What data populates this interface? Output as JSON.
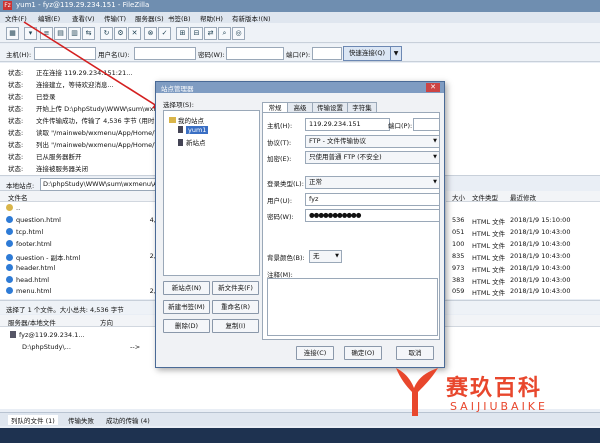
{
  "window": {
    "title": "yum1 - fyz@119.29.234.151 - FileZilla",
    "app_icon": "filezilla-icon"
  },
  "menu": [
    "文件(F)",
    "编辑(E)",
    "查看(V)",
    "传输(T)",
    "服务器(S)",
    "书签(B)",
    "帮助(H)",
    "有新版本!(N)"
  ],
  "quickconnect": {
    "host_label": "主机(H):",
    "user_label": "用户名(U):",
    "pass_label": "密码(W):",
    "port_label": "端口(P):",
    "button": "快速连接(Q)"
  },
  "log": [
    {
      "k": "状态:",
      "v": "正在连接 119.29.234.151:21..."
    },
    {
      "k": "状态:",
      "v": "连接建立，等待欢迎消息..."
    },
    {
      "k": "状态:",
      "v": "已登录"
    },
    {
      "k": "状态:",
      "v": "开始上传 D:\\phpStudy\\WWW\\sum\\wxmenu"
    },
    {
      "k": "状态:",
      "v": "文件传输成功，传输了 4,536 字节 (用时1"
    },
    {
      "k": "状态:",
      "v": "读取 \"/mainweb/wxmenu/App/Home/V"
    },
    {
      "k": "状态:",
      "v": "列出 \"/mainweb/wxmenu/App/Home/V"
    },
    {
      "k": "状态:",
      "v": "已从服务器断开"
    },
    {
      "k": "状态:",
      "v": "连接被服务器关闭"
    }
  ],
  "local": {
    "label": "本地站点:",
    "path": "D:\\phpStudy\\WWW\\sum\\wxmenu\\App\\Home\\V",
    "col_name": "文件名",
    "files": [
      {
        "name": "..",
        "size": ""
      },
      {
        "name": "question.html",
        "size": "4,5"
      },
      {
        "name": "tcp.html",
        "size": "5"
      },
      {
        "name": "footer.html",
        "size": "7"
      },
      {
        "name": "question - 副本.html",
        "size": "2,8"
      },
      {
        "name": "header.html",
        "size": "1"
      },
      {
        "name": "head.html",
        "size": ""
      },
      {
        "name": "menu.html",
        "size": "2,0"
      }
    ]
  },
  "remote": {
    "col_size": "大小",
    "col_type": "文件类型",
    "col_modified": "最近修改",
    "files": [
      {
        "size": "536",
        "type": "HTML 文件",
        "date": "2018/1/9 15:10:00"
      },
      {
        "size": "051",
        "type": "HTML 文件",
        "date": "2018/1/9 10:43:00"
      },
      {
        "size": "100",
        "type": "HTML 文件",
        "date": "2018/1/9 10:43:00"
      },
      {
        "size": "835",
        "type": "HTML 文件",
        "date": "2018/1/9 10:43:00"
      },
      {
        "size": "973",
        "type": "HTML 文件",
        "date": "2018/1/9 10:43:00"
      },
      {
        "size": "383",
        "type": "HTML 文件",
        "date": "2018/1/9 10:43:00"
      },
      {
        "size": "059",
        "type": "HTML 文件",
        "date": "2018/1/9 10:43:00"
      }
    ]
  },
  "status_line": "选择了 1 个文件。大小总共: 4,536 字节",
  "queue": {
    "col_server": "服务器/本地文件",
    "col_dir": "方向",
    "rows": [
      {
        "server": "fyz@119.29.234.1...",
        "dir": ""
      },
      {
        "server": "D:\\phpStudy\\...",
        "dir": "-->"
      }
    ]
  },
  "bottom_tabs": [
    "列队的文件 (1)",
    "传输失败",
    "成功的传输 (4)"
  ],
  "dialog": {
    "title": "站点管理器",
    "select_entry_label": "选择项(S):",
    "tree_root": "我的站点",
    "tree_items": [
      "yum1",
      "新站点"
    ],
    "tabs": [
      "常规",
      "高级",
      "传输设置",
      "字符集"
    ],
    "host_label": "主机(H):",
    "host_value": "119.29.234.151",
    "port_label": "端口(P):",
    "port_value": "",
    "protocol_label": "协议(T):",
    "protocol_value": "FTP - 文件传输协议",
    "encryption_label": "加密(E):",
    "encryption_value": "只使用普通 FTP (不安全)",
    "logon_label": "登录类型(L):",
    "logon_value": "正常",
    "user_label": "用户(U):",
    "user_value": "fyz",
    "password_label": "密码(W):",
    "password_value": "●●●●●●●●●●●",
    "bgcolor_label": "背景颜色(B):",
    "bgcolor_value": "无",
    "comments_label": "注释(M):",
    "buttons": {
      "new_site": "新站点(N)",
      "new_folder": "新文件夹(F)",
      "new_bookmark": "新建书签(M)",
      "rename": "重命名(R)",
      "delete": "删除(D)",
      "copy": "复制(I)",
      "connect": "连接(C)",
      "ok": "确定(O)",
      "cancel": "取消"
    }
  },
  "watermark": {
    "title": "赛玖百科",
    "subtitle": "SAIJIUBAIKE",
    "color": "#e8472d"
  }
}
